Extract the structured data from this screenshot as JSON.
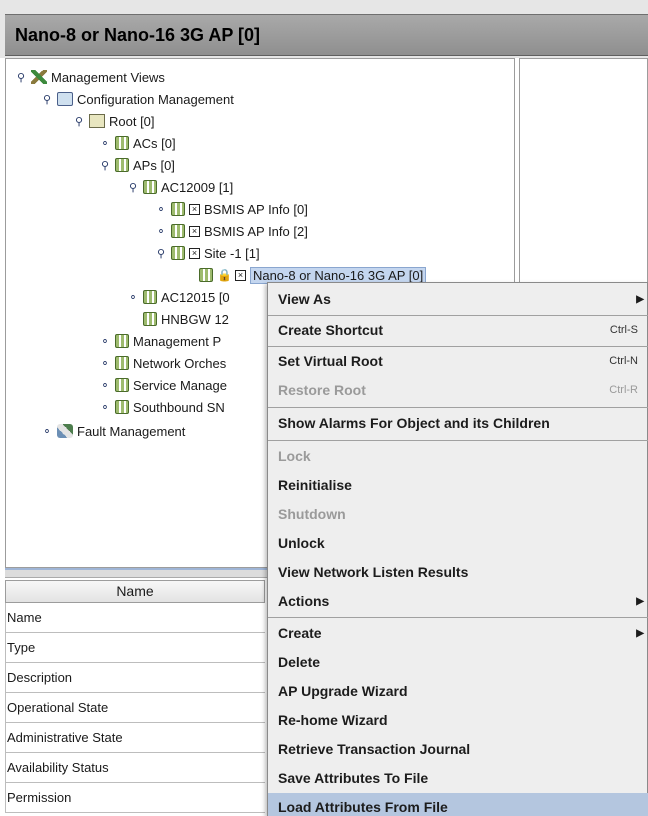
{
  "window": {
    "title": "Nano-8 or Nano-16 3G AP [0]"
  },
  "tree": {
    "management_views": "Management Views",
    "configuration_management": "Configuration Management",
    "root": "Root [0]",
    "acs": "ACs [0]",
    "aps": "APs [0]",
    "ac12009": "AC12009 [1]",
    "bsmis_0": "BSMIS AP Info [0]",
    "bsmis_2": "BSMIS AP Info [2]",
    "site": "Site -1 [1]",
    "nano": "Nano-8 or Nano-16 3G AP [0]",
    "ac12015": "AC12015 [0",
    "hnbgw": "HNBGW 12",
    "management_p": "Management P",
    "network_orches": "Network Orches",
    "service_manage": "Service Manage",
    "southbound": "Southbound SN",
    "fault_management": "Fault Management"
  },
  "properties": {
    "header": "Name",
    "rows": [
      "Name",
      "Type",
      "Description",
      "Operational State",
      "Administrative State",
      "Availability Status",
      "Permission"
    ]
  },
  "menu": {
    "view_as": "View As",
    "create_shortcut": "Create Shortcut",
    "create_shortcut_sc": "Ctrl-S",
    "set_virtual_root": "Set Virtual Root",
    "set_virtual_root_sc": "Ctrl-N",
    "restore_root": "Restore Root",
    "restore_root_sc": "Ctrl-R",
    "show_alarms": "Show Alarms For Object and its Children",
    "lock": "Lock",
    "reinitialise": "Reinitialise",
    "shutdown": "Shutdown",
    "unlock": "Unlock",
    "view_network": "View Network Listen Results",
    "actions": "Actions",
    "create": "Create",
    "delete": "Delete",
    "ap_upgrade": "AP Upgrade Wizard",
    "rehome": "Re-home Wizard",
    "retrieve_journal": "Retrieve Transaction Journal",
    "save_attrs": "Save Attributes To File",
    "load_attrs": "Load Attributes From File"
  }
}
